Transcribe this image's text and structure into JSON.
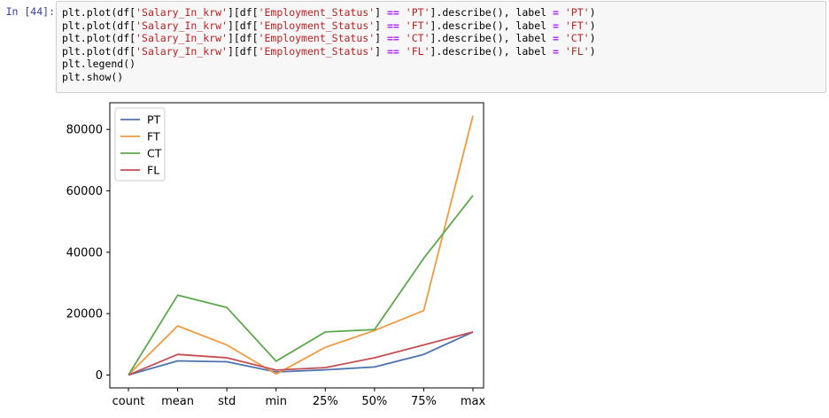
{
  "cell": {
    "prompt": "In [44]:",
    "code_lines": [
      [
        {
          "t": "plt.plot(df[",
          "c": "plain"
        },
        {
          "t": "'Salary_In_krw'",
          "c": "str"
        },
        {
          "t": "][df[",
          "c": "plain"
        },
        {
          "t": "'Employment_Status'",
          "c": "str"
        },
        {
          "t": "] ",
          "c": "plain"
        },
        {
          "t": "==",
          "c": "op"
        },
        {
          "t": " ",
          "c": "plain"
        },
        {
          "t": "'PT'",
          "c": "str"
        },
        {
          "t": "].describe(), label ",
          "c": "plain"
        },
        {
          "t": "=",
          "c": "op"
        },
        {
          "t": " ",
          "c": "plain"
        },
        {
          "t": "'PT'",
          "c": "str"
        },
        {
          "t": ")",
          "c": "plain"
        }
      ],
      [
        {
          "t": "plt.plot(df[",
          "c": "plain"
        },
        {
          "t": "'Salary_In_krw'",
          "c": "str"
        },
        {
          "t": "][df[",
          "c": "plain"
        },
        {
          "t": "'Employment_Status'",
          "c": "str"
        },
        {
          "t": "] ",
          "c": "plain"
        },
        {
          "t": "==",
          "c": "op"
        },
        {
          "t": " ",
          "c": "plain"
        },
        {
          "t": "'FT'",
          "c": "str"
        },
        {
          "t": "].describe(), label ",
          "c": "plain"
        },
        {
          "t": "=",
          "c": "op"
        },
        {
          "t": " ",
          "c": "plain"
        },
        {
          "t": "'FT'",
          "c": "str"
        },
        {
          "t": ")",
          "c": "plain"
        }
      ],
      [
        {
          "t": "plt.plot(df[",
          "c": "plain"
        },
        {
          "t": "'Salary_In_krw'",
          "c": "str"
        },
        {
          "t": "][df[",
          "c": "plain"
        },
        {
          "t": "'Employment_Status'",
          "c": "str"
        },
        {
          "t": "] ",
          "c": "plain"
        },
        {
          "t": "==",
          "c": "op"
        },
        {
          "t": " ",
          "c": "plain"
        },
        {
          "t": "'CT'",
          "c": "str"
        },
        {
          "t": "].describe(), label ",
          "c": "plain"
        },
        {
          "t": "=",
          "c": "op"
        },
        {
          "t": " ",
          "c": "plain"
        },
        {
          "t": "'CT'",
          "c": "str"
        },
        {
          "t": ")",
          "c": "plain"
        }
      ],
      [
        {
          "t": "plt.plot(df[",
          "c": "plain"
        },
        {
          "t": "'Salary_In_krw'",
          "c": "str"
        },
        {
          "t": "][df[",
          "c": "plain"
        },
        {
          "t": "'Employment_Status'",
          "c": "str"
        },
        {
          "t": "] ",
          "c": "plain"
        },
        {
          "t": "==",
          "c": "op"
        },
        {
          "t": " ",
          "c": "plain"
        },
        {
          "t": "'FL'",
          "c": "str"
        },
        {
          "t": "].describe(), label ",
          "c": "plain"
        },
        {
          "t": "=",
          "c": "op"
        },
        {
          "t": " ",
          "c": "plain"
        },
        {
          "t": "'FL'",
          "c": "str"
        },
        {
          "t": ")",
          "c": "plain"
        }
      ],
      [
        {
          "t": "plt.legend()",
          "c": "plain"
        }
      ],
      [
        {
          "t": "plt.show()",
          "c": "plain"
        }
      ]
    ]
  },
  "chart_data": {
    "type": "line",
    "categories": [
      "count",
      "mean",
      "std",
      "min",
      "25%",
      "50%",
      "75%",
      "max"
    ],
    "series": [
      {
        "name": "PT",
        "color": "#4c72b0",
        "values": [
          8,
          4600,
          4300,
          1000,
          1700,
          2600,
          6700,
          14000
        ]
      },
      {
        "name": "FT",
        "color": "#ef9b40",
        "values": [
          80,
          16000,
          9800,
          300,
          9000,
          14500,
          21000,
          84500
        ]
      },
      {
        "name": "CT",
        "color": "#5da84a",
        "values": [
          5,
          26000,
          22000,
          4500,
          14000,
          14800,
          38000,
          58500
        ]
      },
      {
        "name": "FL",
        "color": "#c44e52",
        "values": [
          12,
          6700,
          5600,
          1600,
          2400,
          5600,
          9800,
          14000
        ]
      }
    ],
    "yticks": [
      0,
      20000,
      40000,
      60000,
      80000
    ],
    "ylim": [
      -4200,
      88700
    ],
    "legend_position": "upper left",
    "grid": false
  }
}
